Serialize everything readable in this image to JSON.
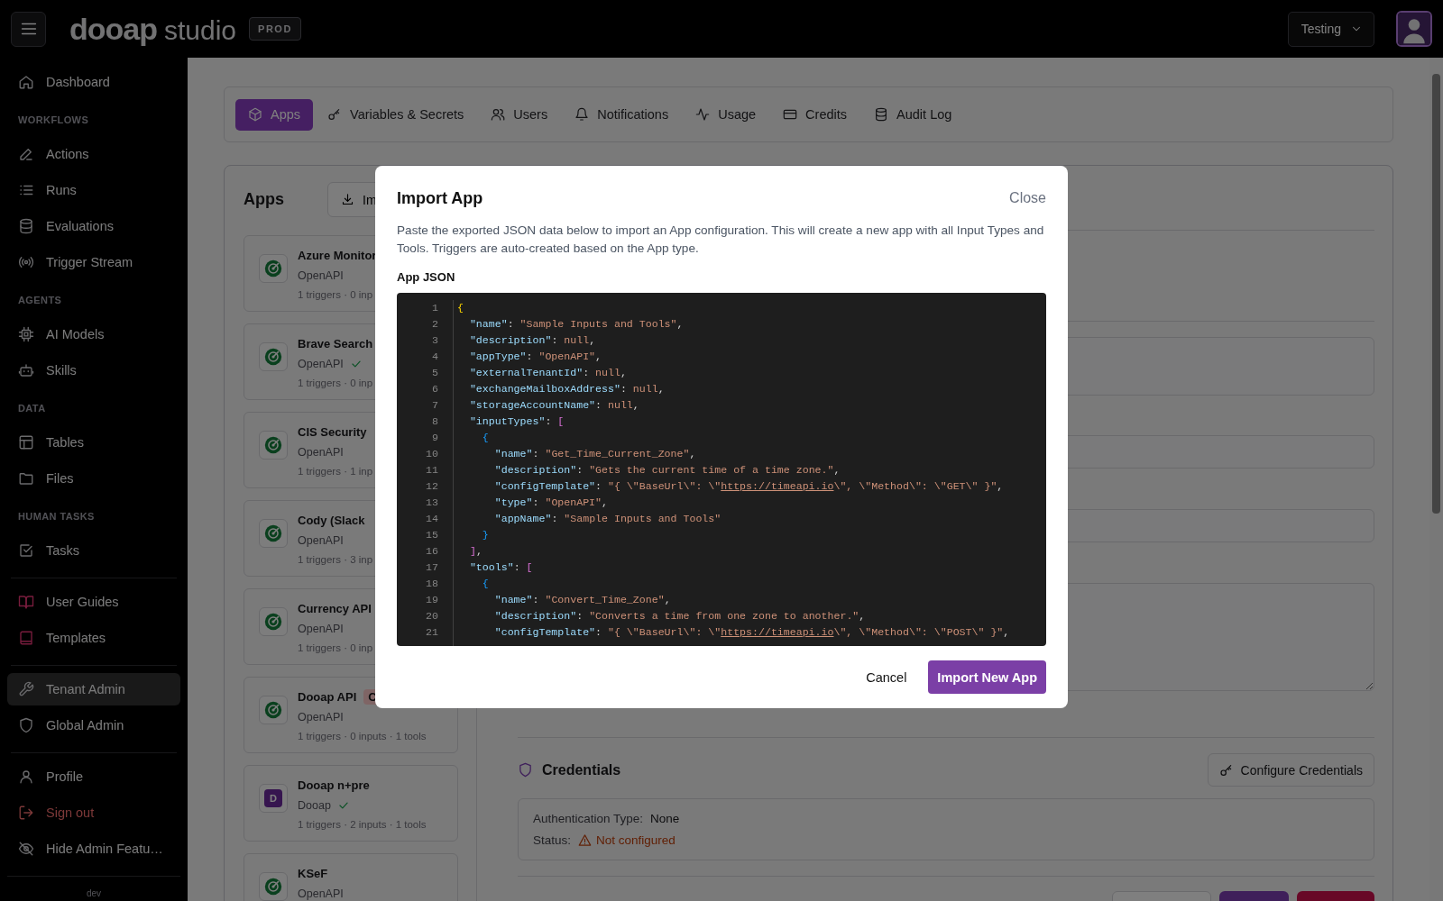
{
  "topbar": {
    "logo_primary": "dooap",
    "logo_secondary": "studio",
    "environment": "PROD",
    "workspace": "Testing"
  },
  "sidebar": {
    "groups": [
      {
        "sections": [
          {
            "items": [
              {
                "label": "Dashboard",
                "kind": "nav",
                "selected": false
              }
            ]
          },
          {
            "heading": "WORKFLOWS",
            "items": [
              {
                "label": "Actions",
                "kind": "nav",
                "selected": false
              },
              {
                "label": "Runs",
                "kind": "nav",
                "selected": false
              },
              {
                "label": "Evaluations",
                "kind": "nav",
                "selected": false
              },
              {
                "label": "Trigger Stream",
                "kind": "nav",
                "selected": false
              }
            ]
          },
          {
            "heading": "AGENTS",
            "items": [
              {
                "label": "AI Models",
                "kind": "nav",
                "selected": false
              },
              {
                "label": "Skills",
                "kind": "nav",
                "selected": false
              }
            ]
          },
          {
            "heading": "DATA",
            "items": [
              {
                "label": "Tables",
                "kind": "nav",
                "selected": false
              },
              {
                "label": "Files",
                "kind": "nav",
                "selected": false
              }
            ]
          },
          {
            "heading": "HUMAN TASKS",
            "items": [
              {
                "label": "Tasks",
                "kind": "nav",
                "selected": false
              }
            ]
          }
        ]
      },
      {
        "sections": [
          {
            "items": [
              {
                "label": "User Guides",
                "kind": "guide",
                "selected": false
              },
              {
                "label": "Templates",
                "kind": "guide",
                "selected": false
              }
            ]
          }
        ]
      },
      {
        "sections": [
          {
            "items": [
              {
                "label": "Tenant Admin",
                "kind": "nav",
                "selected": true
              },
              {
                "label": "Global Admin",
                "kind": "nav",
                "selected": false
              }
            ]
          }
        ]
      },
      {
        "sections": [
          {
            "items": [
              {
                "label": "Profile",
                "kind": "nav",
                "selected": false
              },
              {
                "label": "Sign out",
                "kind": "danger",
                "selected": false
              },
              {
                "label": "Hide Admin Featu…",
                "kind": "nav",
                "selected": false
              }
            ]
          }
        ]
      }
    ],
    "footer": "dev"
  },
  "tabs": [
    {
      "label": "Apps",
      "selected": true
    },
    {
      "label": "Variables & Secrets",
      "selected": false
    },
    {
      "label": "Users",
      "selected": false
    },
    {
      "label": "Notifications",
      "selected": false
    },
    {
      "label": "Usage",
      "selected": false
    },
    {
      "label": "Credits",
      "selected": false
    },
    {
      "label": "Audit Log",
      "selected": false
    }
  ],
  "apps_panel": {
    "title": "Apps",
    "import_button": "Im",
    "apps": [
      {
        "name": "Azure Monitor",
        "kind": "openapi",
        "type": "OpenAPI",
        "verified": false,
        "meta": "1 triggers · 0 inp"
      },
      {
        "name": "Brave Search",
        "kind": "openapi",
        "type": "OpenAPI",
        "verified": true,
        "meta": "1 triggers · 0 inp"
      },
      {
        "name": "CIS Security",
        "kind": "openapi",
        "type": "OpenAPI",
        "verified": false,
        "meta": "1 triggers · 1 inp"
      },
      {
        "name": "Cody (Slack",
        "kind": "openapi",
        "type": "OpenAPI",
        "verified": false,
        "meta": "1 triggers · 3 inp"
      },
      {
        "name": "Currency API",
        "kind": "openapi",
        "type": "OpenAPI",
        "verified": false,
        "meta": "1 triggers · 0 inp"
      },
      {
        "name": "Dooap API",
        "kind": "openapi",
        "badge": "C",
        "type": "OpenAPI",
        "verified": false,
        "meta": "1 triggers · 0 inputs · 1 tools"
      },
      {
        "name": "Dooap n+pre",
        "kind": "letter",
        "letter": "D",
        "type": "Dooap",
        "verified": true,
        "meta": "1 triggers · 2 inputs · 1 tools"
      },
      {
        "name": "KSeF",
        "kind": "openapi",
        "type": "OpenAPI",
        "verified": false
      }
    ]
  },
  "credentials": {
    "title": "Credentials",
    "configure_button": "Configure Credentials",
    "fields": [
      {
        "label": "Authentication Type:",
        "value": "None",
        "kind": "plain"
      },
      {
        "label": "Status:",
        "value": "Not configured",
        "kind": "warning"
      }
    ]
  },
  "modal": {
    "title": "Import App",
    "close": "Close",
    "description": "Paste the exported JSON data below to import an App configuration. This will create a new app with all Input Types and Tools. Triggers are auto-created based on the App type.",
    "field_label": "App JSON",
    "code_lines": [
      {
        "number": "1",
        "tokens": [
          {
            "kind": "brace1",
            "text": "{"
          }
        ]
      },
      {
        "number": "2",
        "tokens": [
          {
            "kind": "key",
            "text": "  \"name\""
          },
          {
            "kind": "punct",
            "text": ": "
          },
          {
            "kind": "string",
            "text": "\"Sample Inputs and Tools\""
          },
          {
            "kind": "punct",
            "text": ","
          }
        ]
      },
      {
        "number": "3",
        "tokens": [
          {
            "kind": "key",
            "text": "  \"description\""
          },
          {
            "kind": "punct",
            "text": ": "
          },
          {
            "kind": "string",
            "text": "null"
          },
          {
            "kind": "punct",
            "text": ","
          }
        ]
      },
      {
        "number": "4",
        "tokens": [
          {
            "kind": "key",
            "text": "  \"appType\""
          },
          {
            "kind": "punct",
            "text": ": "
          },
          {
            "kind": "string",
            "text": "\"OpenAPI\""
          },
          {
            "kind": "punct",
            "text": ","
          }
        ]
      },
      {
        "number": "5",
        "tokens": [
          {
            "kind": "key",
            "text": "  \"externalTenantId\""
          },
          {
            "kind": "punct",
            "text": ": "
          },
          {
            "kind": "string",
            "text": "null"
          },
          {
            "kind": "punct",
            "text": ","
          }
        ]
      },
      {
        "number": "6",
        "tokens": [
          {
            "kind": "key",
            "text": "  \"exchangeMailboxAddress\""
          },
          {
            "kind": "punct",
            "text": ": "
          },
          {
            "kind": "string",
            "text": "null"
          },
          {
            "kind": "punct",
            "text": ","
          }
        ]
      },
      {
        "number": "7",
        "tokens": [
          {
            "kind": "key",
            "text": "  \"storageAccountName\""
          },
          {
            "kind": "punct",
            "text": ": "
          },
          {
            "kind": "string",
            "text": "null"
          },
          {
            "kind": "punct",
            "text": ","
          }
        ]
      },
      {
        "number": "8",
        "tokens": [
          {
            "kind": "key",
            "text": "  \"inputTypes\""
          },
          {
            "kind": "punct",
            "text": ": "
          },
          {
            "kind": "brace2",
            "text": "["
          }
        ]
      },
      {
        "number": "9",
        "tokens": [
          {
            "kind": "brace3",
            "text": "    {"
          }
        ]
      },
      {
        "number": "10",
        "tokens": [
          {
            "kind": "key",
            "text": "      \"name\""
          },
          {
            "kind": "punct",
            "text": ": "
          },
          {
            "kind": "string",
            "text": "\"Get_Time_Current_Zone\""
          },
          {
            "kind": "punct",
            "text": ","
          }
        ]
      },
      {
        "number": "11",
        "tokens": [
          {
            "kind": "key",
            "text": "      \"description\""
          },
          {
            "kind": "punct",
            "text": ": "
          },
          {
            "kind": "string",
            "text": "\"Gets the current time of a time zone.\""
          },
          {
            "kind": "punct",
            "text": ","
          }
        ]
      },
      {
        "number": "12",
        "tokens": [
          {
            "kind": "key",
            "text": "      \"configTemplate\""
          },
          {
            "kind": "punct",
            "text": ": "
          },
          {
            "kind": "string",
            "text": "\"{ \\\"BaseUrl\\\": \\\""
          },
          {
            "kind": "link",
            "text": "https://timeapi.io"
          },
          {
            "kind": "string",
            "text": "\\\", \\\"Method\\\": \\\"GET\\\" }\""
          },
          {
            "kind": "punct",
            "text": ","
          }
        ]
      },
      {
        "number": "13",
        "tokens": [
          {
            "kind": "key",
            "text": "      \"type\""
          },
          {
            "kind": "punct",
            "text": ": "
          },
          {
            "kind": "string",
            "text": "\"OpenAPI\""
          },
          {
            "kind": "punct",
            "text": ","
          }
        ]
      },
      {
        "number": "14",
        "tokens": [
          {
            "kind": "key",
            "text": "      \"appName\""
          },
          {
            "kind": "punct",
            "text": ": "
          },
          {
            "kind": "string",
            "text": "\"Sample Inputs and Tools\""
          }
        ]
      },
      {
        "number": "15",
        "tokens": [
          {
            "kind": "brace3",
            "text": "    }"
          }
        ]
      },
      {
        "number": "16",
        "tokens": [
          {
            "kind": "brace2",
            "text": "  ]"
          },
          {
            "kind": "punct",
            "text": ","
          }
        ]
      },
      {
        "number": "17",
        "tokens": [
          {
            "kind": "key",
            "text": "  \"tools\""
          },
          {
            "kind": "punct",
            "text": ": "
          },
          {
            "kind": "brace2",
            "text": "["
          }
        ]
      },
      {
        "number": "18",
        "tokens": [
          {
            "kind": "brace3",
            "text": "    {"
          }
        ]
      },
      {
        "number": "19",
        "tokens": [
          {
            "kind": "key",
            "text": "      \"name\""
          },
          {
            "kind": "punct",
            "text": ": "
          },
          {
            "kind": "string",
            "text": "\"Convert_Time_Zone\""
          },
          {
            "kind": "punct",
            "text": ","
          }
        ]
      },
      {
        "number": "20",
        "tokens": [
          {
            "kind": "key",
            "text": "      \"description\""
          },
          {
            "kind": "punct",
            "text": ": "
          },
          {
            "kind": "string",
            "text": "\"Converts a time from one zone to another.\""
          },
          {
            "kind": "punct",
            "text": ","
          }
        ]
      },
      {
        "number": "21",
        "tokens": [
          {
            "kind": "key",
            "text": "      \"configTemplate\""
          },
          {
            "kind": "punct",
            "text": ": "
          },
          {
            "kind": "string",
            "text": "\"{ \\\"BaseUrl\\\": \\\""
          },
          {
            "kind": "link",
            "text": "https://timeapi.io"
          },
          {
            "kind": "string",
            "text": "\\\", \\\"Method\\\": \\\"POST\\\" }\""
          },
          {
            "kind": "punct",
            "text": ","
          }
        ]
      }
    ],
    "buttons": [
      {
        "label": "Cancel",
        "kind": "secondary"
      },
      {
        "label": "Import New App",
        "kind": "primary"
      }
    ]
  }
}
